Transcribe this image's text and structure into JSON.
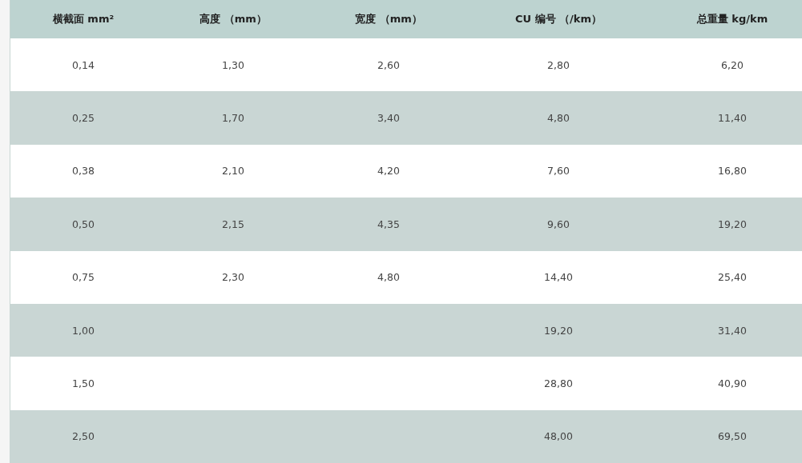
{
  "table": {
    "columns": [
      "横截面 mm²",
      "高度 （mm）",
      "宽度 （mm）",
      "CU 编号 （/km）",
      "总重量 kg/km"
    ],
    "rows": [
      [
        "0,14",
        "1,30",
        "2,60",
        "2,80",
        "6,20"
      ],
      [
        "0,25",
        "1,70",
        "3,40",
        "4,80",
        "11,40"
      ],
      [
        "0,38",
        "2,10",
        "4,20",
        "7,60",
        "16,80"
      ],
      [
        "0,50",
        "2,15",
        "4,35",
        "9,60",
        "19,20"
      ],
      [
        "0,75",
        "2,30",
        "4,80",
        "14,40",
        "25,40"
      ],
      [
        "1,00",
        null,
        null,
        "19,20",
        "31,40"
      ],
      [
        "1,50",
        null,
        null,
        "28,80",
        "40,90"
      ],
      [
        "2,50",
        null,
        null,
        "48,00",
        "69,50"
      ]
    ]
  }
}
